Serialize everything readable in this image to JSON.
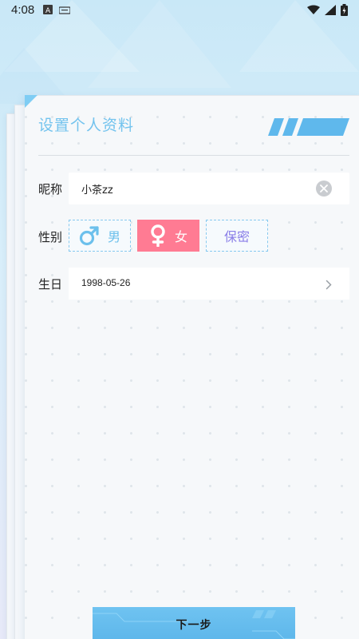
{
  "status_bar": {
    "time": "4:08"
  },
  "page": {
    "title": "设置个人资料",
    "nickname_label": "昵称",
    "nickname_value": "小茶zz",
    "gender_label": "性别",
    "gender_options": [
      {
        "label": "男",
        "icon": "male-icon",
        "selected": false
      },
      {
        "label": "女",
        "icon": "female-icon",
        "selected": true
      },
      {
        "label": "保密",
        "selected": false
      }
    ],
    "birthday_label": "生日",
    "birthday_value": "1998-05-26",
    "next_button": "下一步"
  },
  "colors": {
    "accent": "#73c3ee",
    "female_selected": "#ff7b93",
    "secret_text": "#8a7ee8",
    "button": "#6fc3f1"
  }
}
